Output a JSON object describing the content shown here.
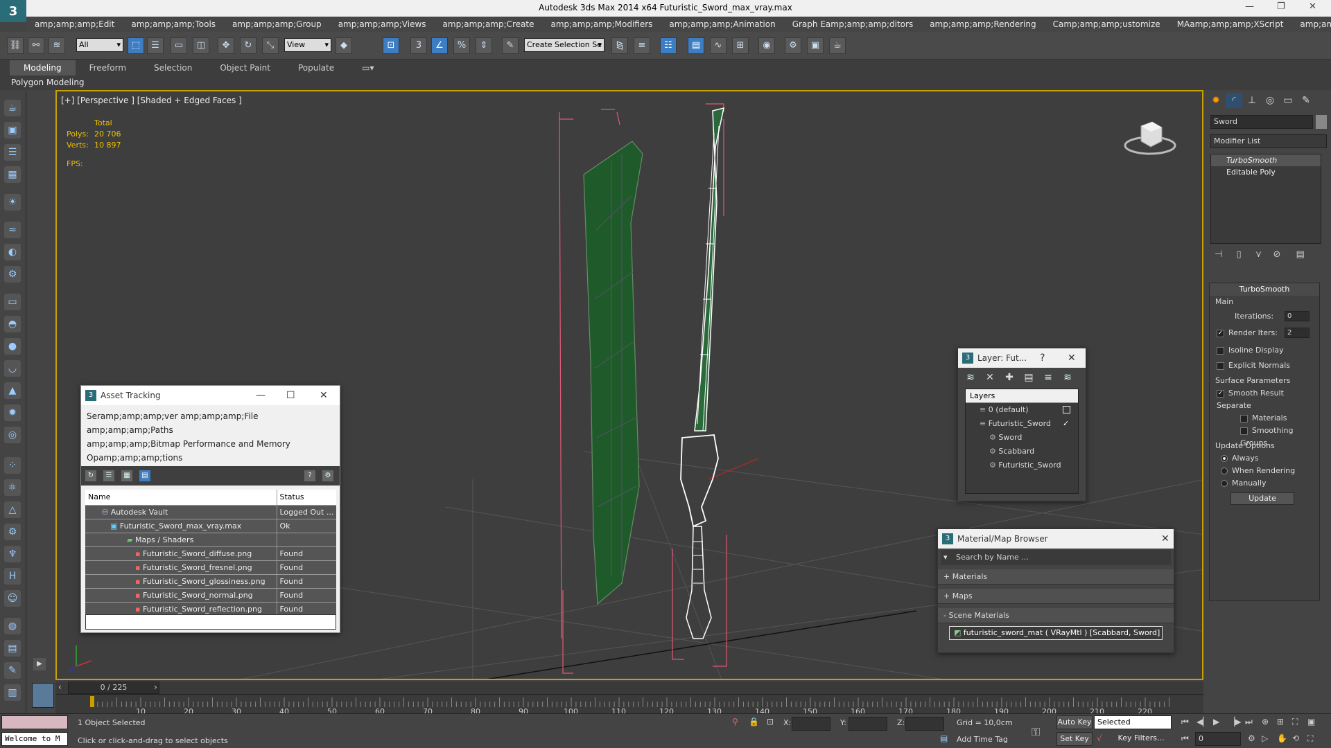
{
  "window": {
    "title": "Autodesk 3ds Max  2014 x64     Futuristic_Sword_max_vray.max"
  },
  "menu": [
    "amp;amp;amp;Edit",
    "amp;amp;amp;Tools",
    "amp;amp;amp;Group",
    "amp;amp;amp;Views",
    "amp;amp;amp;Create",
    "amp;amp;amp;Modifiers",
    "amp;amp;amp;Animation",
    "Graph Eamp;amp;amp;ditors",
    "amp;amp;amp;Rendering",
    "Camp;amp;amp;ustomize",
    "MAamp;amp;amp;XScript",
    "amp;amp;amp;Help"
  ],
  "toolbar": {
    "filter": "All",
    "refcoord": "View",
    "selset": "Create Selection Se"
  },
  "ribbon": {
    "tabs": [
      "Modeling",
      "Freeform",
      "Selection",
      "Object Paint",
      "Populate"
    ],
    "sub": "Polygon Modeling"
  },
  "viewport": {
    "label": "[+] [Perspective ] [Shaded + Edged Faces ]",
    "stats": {
      "total": "Total",
      "polys_label": "Polys:",
      "polys": "20 706",
      "verts_label": "Verts:",
      "verts": "10 897",
      "fps_label": "FPS:"
    }
  },
  "cmdpanel": {
    "object_name": "Sword",
    "modifier_list": "Modifier List",
    "stack": [
      "TurboSmooth",
      "Editable Poly"
    ],
    "turbosmooth": {
      "title": "TurboSmooth",
      "main": "Main",
      "iterations_label": "Iterations:",
      "iterations": "0",
      "render_iters_label": "Render Iters:",
      "render_iters": "2",
      "isoline": "Isoline Display",
      "explicit": "Explicit Normals",
      "surface": "Surface Parameters",
      "smooth_result": "Smooth Result",
      "separate": "Separate",
      "materials": "Materials",
      "smoothing": "Smoothing Groups",
      "update_options": "Update Options",
      "always": "Always",
      "when_rendering": "When Rendering",
      "manually": "Manually",
      "update_btn": "Update"
    }
  },
  "asset": {
    "title": "Asset Tracking",
    "menu1": "Seramp;amp;amp;ver    amp;amp;amp;File    amp;amp;amp;Paths",
    "menu2": "amp;amp;amp;Bitmap Performance and Memory",
    "menu3": "Opamp;amp;amp;tions",
    "col_name": "Name",
    "col_status": "Status",
    "rows": [
      {
        "name": "Autodesk Vault",
        "status": "Logged Out ..."
      },
      {
        "name": "Futuristic_Sword_max_vray.max",
        "status": "Ok"
      },
      {
        "name": "Maps / Shaders",
        "status": ""
      },
      {
        "name": "Futuristic_Sword_diffuse.png",
        "status": "Found"
      },
      {
        "name": "Futuristic_Sword_fresnel.png",
        "status": "Found"
      },
      {
        "name": "Futuristic_Sword_glossiness.png",
        "status": "Found"
      },
      {
        "name": "Futuristic_Sword_normal.png",
        "status": "Found"
      },
      {
        "name": "Futuristic_Sword_reflection.png",
        "status": "Found"
      }
    ]
  },
  "layers": {
    "title": "Layer: Fut...",
    "header": "Layers",
    "items": [
      "0 (default)",
      "Futuristic_Sword",
      "Sword",
      "Scabbard",
      "Futuristic_Sword"
    ]
  },
  "matbrowser": {
    "title": "Material/Map Browser",
    "search": "Search by Name ...",
    "materials": "+ Materials",
    "maps": "+ Maps",
    "scene": "- Scene Materials",
    "item": "futuristic_sword_mat  ( VRayMtl ) [Scabbard, Sword]"
  },
  "timeline": {
    "slider": "0 / 225",
    "ticks": [
      "10",
      "20",
      "30",
      "40",
      "50",
      "60",
      "70",
      "80",
      "90",
      "100",
      "110",
      "120",
      "130",
      "140",
      "150",
      "160",
      "170",
      "180",
      "190",
      "200",
      "210",
      "220"
    ]
  },
  "status": {
    "welcome": "Welcome to M",
    "selected": "1 Object Selected",
    "hint": "Click or click-and-drag to select objects",
    "x": "X:",
    "y": "Y:",
    "z": "Z:",
    "grid": "Grid = 10,0cm",
    "addtag": "Add Time Tag",
    "autokey": "Auto Key",
    "setkey": "Set Key",
    "selected_dd": "Selected",
    "keyfilters": "Key Filters...",
    "frame": "0"
  },
  "colors": {
    "accent": "#3c7dc4",
    "viewport_border": "#c8a000",
    "stats": "#f0c000"
  }
}
